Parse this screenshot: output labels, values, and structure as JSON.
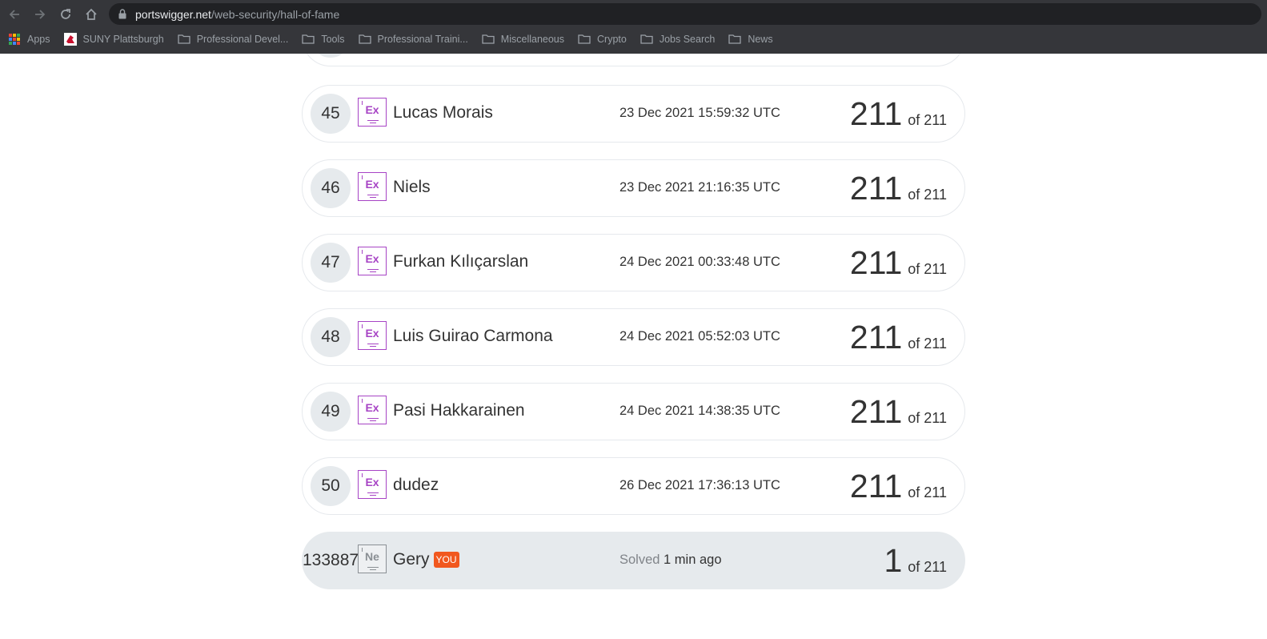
{
  "browser": {
    "url_host": "portswigger.net",
    "url_path": "/web-security/hall-of-fame",
    "bookmarks": [
      {
        "label": "Apps",
        "icon": "apps-grid-icon"
      },
      {
        "label": "SUNY Plattsburgh",
        "icon": "cardinal-favicon-icon"
      },
      {
        "label": "Professional Devel...",
        "icon": "folder-icon"
      },
      {
        "label": "Tools",
        "icon": "folder-icon"
      },
      {
        "label": "Professional Traini...",
        "icon": "folder-icon"
      },
      {
        "label": "Miscellaneous",
        "icon": "folder-icon"
      },
      {
        "label": "Crypto",
        "icon": "folder-icon"
      },
      {
        "label": "Jobs Search",
        "icon": "folder-icon"
      },
      {
        "label": "News",
        "icon": "folder-icon"
      }
    ]
  },
  "leaderboard": {
    "rows": [
      {
        "rank": "45",
        "badge": "Ex",
        "name": "Lucas Morais",
        "time": "23 Dec 2021 15:59:32 UTC",
        "score": "211",
        "of": "of 211"
      },
      {
        "rank": "46",
        "badge": "Ex",
        "name": "Niels",
        "time": "23 Dec 2021 21:16:35 UTC",
        "score": "211",
        "of": "of 211"
      },
      {
        "rank": "47",
        "badge": "Ex",
        "name": "Furkan Kılıçarslan",
        "time": "24 Dec 2021 00:33:48 UTC",
        "score": "211",
        "of": "of 211"
      },
      {
        "rank": "48",
        "badge": "Ex",
        "name": "Luis Guirao Carmona",
        "time": "24 Dec 2021 05:52:03 UTC",
        "score": "211",
        "of": "of 211"
      },
      {
        "rank": "49",
        "badge": "Ex",
        "name": "Pasi Hakkarainen",
        "time": "24 Dec 2021 14:38:35 UTC",
        "score": "211",
        "of": "of 211"
      },
      {
        "rank": "50",
        "badge": "Ex",
        "name": "dudez",
        "time": "26 Dec 2021 17:36:13 UTC",
        "score": "211",
        "of": "of 211"
      }
    ],
    "you": {
      "rank": "133887",
      "badge": "Ne",
      "name": "Gery",
      "tag": "YOU",
      "solved_label": "Solved",
      "solved_time": "1 min ago",
      "score": "1",
      "of": "of 211"
    }
  },
  "colors": {
    "expert_badge": "#a744c5",
    "novice_badge": "#8a8f94",
    "you_tag": "#f1581f",
    "row_highlight": "#e6eaed"
  }
}
